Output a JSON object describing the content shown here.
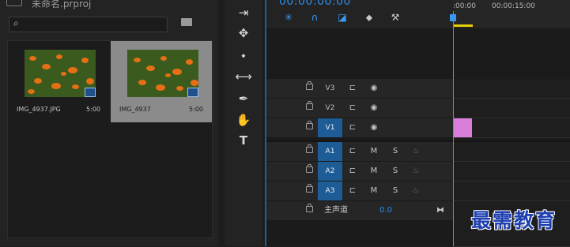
{
  "project": {
    "title": "未命名.prproj",
    "search_placeholder": "",
    "clips": [
      {
        "name": "IMG_4937.JPG",
        "duration": "5:00",
        "selected": false
      },
      {
        "name": "IMG_4937",
        "duration": "5:00",
        "selected": true
      }
    ]
  },
  "tools": [
    {
      "icon": "track-select-forward-icon"
    },
    {
      "icon": "ripple-edit-icon"
    },
    {
      "icon": "razor-icon"
    },
    {
      "icon": "slip-icon"
    },
    {
      "icon": "pen-icon"
    },
    {
      "icon": "hand-icon"
    },
    {
      "icon": "type-icon"
    }
  ],
  "timeline": {
    "timecode": "00:00:00:00",
    "ruler_labels": [
      ":00:00",
      "00:00:15:00"
    ],
    "tracks": [
      {
        "label": "V3",
        "kind": "video",
        "active": false
      },
      {
        "label": "V2",
        "kind": "video",
        "active": false
      },
      {
        "label": "V1",
        "kind": "video",
        "active": true
      },
      {
        "label": "A1",
        "kind": "audio",
        "active": true,
        "m": "M",
        "s": "S"
      },
      {
        "label": "A2",
        "kind": "audio",
        "active": true,
        "m": "M",
        "s": "S"
      },
      {
        "label": "A3",
        "kind": "audio",
        "active": true,
        "m": "M",
        "s": "S"
      }
    ],
    "master": {
      "label": "主声道",
      "value": "0.0"
    }
  },
  "watermark": "最需教育",
  "colors": {
    "accent": "#2d8ceb",
    "track_active": "#1d5c94",
    "clip_pink": "#d97edb",
    "workbar": "#e4d000"
  }
}
